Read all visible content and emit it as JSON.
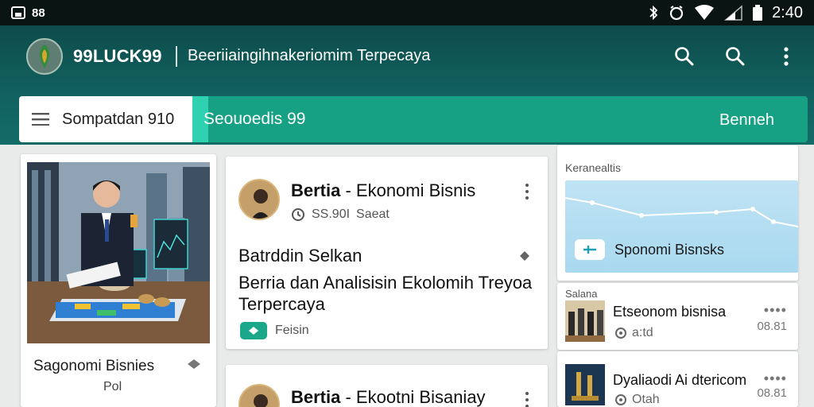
{
  "status_bar": {
    "left_text": "88",
    "time": "2:40",
    "icons": [
      "gallery-icon",
      "bluetooth-icon",
      "alarm-icon",
      "wifi-icon",
      "signal-icon",
      "battery-icon"
    ]
  },
  "app_bar": {
    "brand": "99LUCK99",
    "tagline": "Beeriiaingihnakeriomim Terpecaya",
    "actions": [
      "search-icon",
      "search-icon",
      "more-vert-icon"
    ],
    "color_primary": "#116260"
  },
  "tabs": {
    "active_label": "Sompatdan 910",
    "second_label": "Seouoedis 99",
    "right_label": "Benneh",
    "accent_color": "#16a084"
  },
  "left_card": {
    "title": "Sagonomi Bisnies",
    "sub": "Pol"
  },
  "article_1": {
    "title_bold": "Bertia",
    "title_rest": " - Ekonomi Bisnis",
    "meta_time": "SS.90I",
    "meta_label": "Saeat",
    "headline": "Batrddin Selkan",
    "body": "Berria dan Analisisin Ekolomih Treyoa Terpercaya",
    "tag_label": "Feisin"
  },
  "article_2": {
    "title_bold": "Bertia",
    "title_rest": " - Ekootni Bisaniay"
  },
  "right_panel": {
    "header": "Keranealtis",
    "chart_label": "Sponomi Bisnsks",
    "item1": {
      "section": "Salana",
      "title": "Etseonom bisnisa",
      "meta": "a:td",
      "date": "08.81",
      "dots": "••••"
    },
    "item2": {
      "title": "Dyaliaodi Ai dtericom",
      "meta": "Otah",
      "date": "08.81",
      "dots": "••••"
    }
  }
}
